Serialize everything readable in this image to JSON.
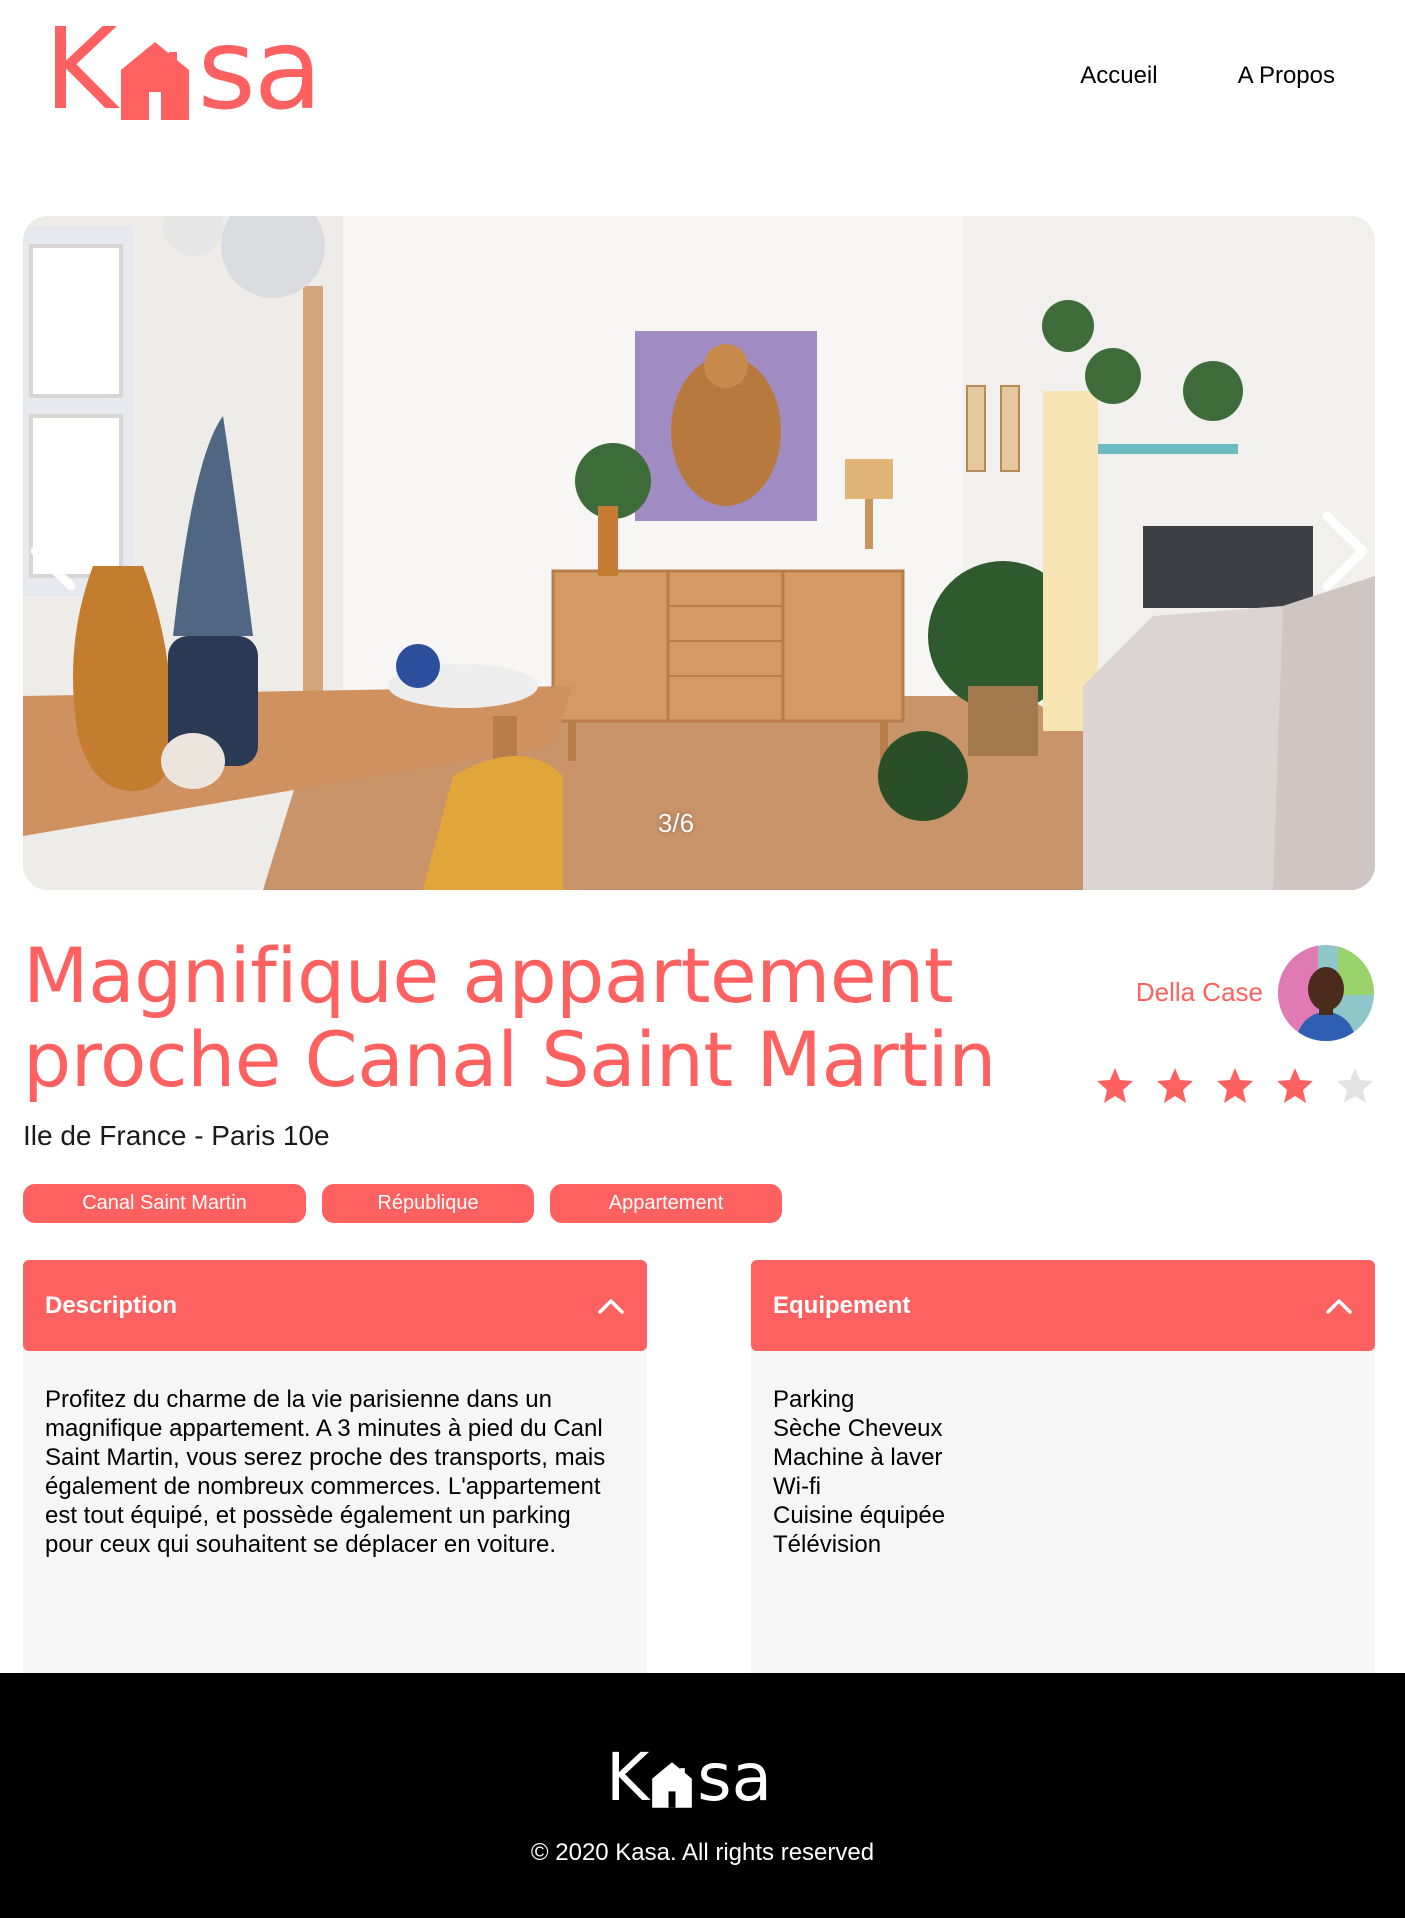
{
  "brand": {
    "logo_text_left": "K",
    "logo_text_right": "sa",
    "accent_color": "#FF6060"
  },
  "nav": {
    "home": "Accueil",
    "about": "A Propos"
  },
  "carousel": {
    "counter": "3/6",
    "prev_icon": "chevron-left-icon",
    "next_icon": "chevron-right-icon"
  },
  "listing": {
    "title": "Magnifique appartement proche Canal Saint Martin",
    "location": "Ile de France - Paris 10e",
    "tags": [
      "Canal Saint Martin",
      "République",
      "Appartement"
    ]
  },
  "host": {
    "name": "Della Case",
    "rating": 4,
    "rating_max": 5
  },
  "description": {
    "title": "Description",
    "text": "Profitez du charme de la vie parisienne dans un magnifique appartement. A 3 minutes à pied du Canl Saint Martin, vous serez proche des transports, mais également de nombreux commerces. L'appartement est tout équipé, et possède également un parking pour ceux qui souhaitent se déplacer en voiture."
  },
  "equipment": {
    "title": "Equipement",
    "items": [
      "Parking",
      "Sèche Cheveux",
      "Machine à laver",
      "Wi-fi",
      "Cuisine équipée",
      "Télévision"
    ]
  },
  "footer": {
    "logo_text_left": "K",
    "logo_text_right": "sa",
    "copyright": "© 2020 Kasa. All rights reserved"
  }
}
